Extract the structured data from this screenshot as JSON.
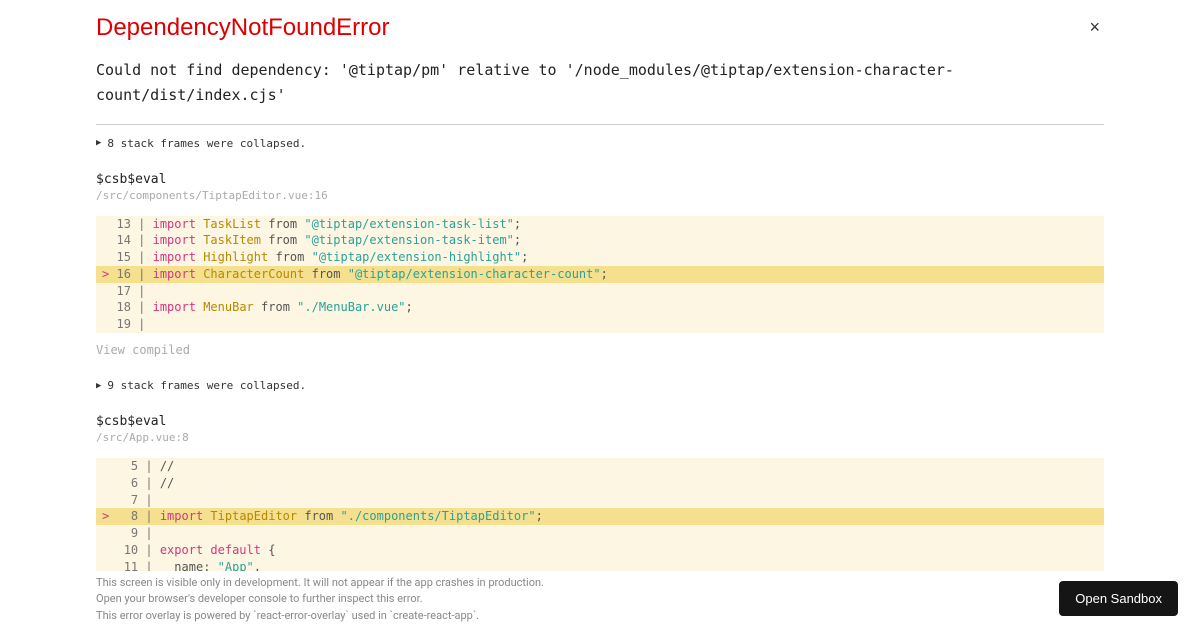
{
  "error": {
    "title": "DependencyNotFoundError",
    "message": "Could not find dependency: '@tiptap/pm' relative to '/node_modules/@tiptap/extension-character-count/dist/index.cjs'"
  },
  "frames": [
    {
      "collapsed_label": "8 stack frames were collapsed.",
      "func": "$csb$eval",
      "location": "/src/components/TiptapEditor.vue:16",
      "code": [
        {
          "n": 13,
          "hl": false,
          "t": "import",
          "ident": "TaskList",
          "kw2": "from",
          "str": "\"@tiptap/extension-task-list\"",
          "end": ";"
        },
        {
          "n": 14,
          "hl": false,
          "t": "import",
          "ident": "TaskItem",
          "kw2": "from",
          "str": "\"@tiptap/extension-task-item\"",
          "end": ";"
        },
        {
          "n": 15,
          "hl": false,
          "t": "import",
          "ident": "Highlight",
          "kw2": "from",
          "str": "\"@tiptap/extension-highlight\"",
          "end": ";"
        },
        {
          "n": 16,
          "hl": true,
          "t": "import",
          "ident": "CharacterCount",
          "kw2": "from",
          "str": "\"@tiptap/extension-character-count\"",
          "end": ";"
        },
        {
          "n": 17,
          "hl": false,
          "blank": true
        },
        {
          "n": 18,
          "hl": false,
          "t": "import",
          "ident": "MenuBar",
          "kw2": "from",
          "str": "\"./MenuBar.vue\"",
          "end": ";"
        },
        {
          "n": 19,
          "hl": false,
          "blank": true
        }
      ],
      "view_compiled": "View compiled"
    },
    {
      "collapsed_label": "9 stack frames were collapsed.",
      "func": "$csb$eval",
      "location": "/src/App.vue:8",
      "code2": [
        {
          "n": 5,
          "raw": "//"
        },
        {
          "n": 6,
          "raw": "//"
        },
        {
          "n": 7,
          "blank": true
        },
        {
          "n": 8,
          "hl": true,
          "t": "import",
          "ident": "TiptapEditor",
          "kw2": "from",
          "str": "\"./components/TiptapEditor\"",
          "end": ";"
        },
        {
          "n": 9,
          "blank": true
        },
        {
          "n": 10,
          "export": "export default",
          "brace": " {"
        },
        {
          "n": 11,
          "name_line": true,
          "key": "name",
          "val": "\"App\"",
          "tail": ","
        }
      ]
    }
  ],
  "footer": {
    "l1": "This screen is visible only in development. It will not appear if the app crashes in production.",
    "l2": "Open your browser's developer console to further inspect this error.",
    "l3": "This error overlay is powered by `react-error-overlay` used in `create-react-app`."
  },
  "sandbox_button": "Open Sandbox"
}
